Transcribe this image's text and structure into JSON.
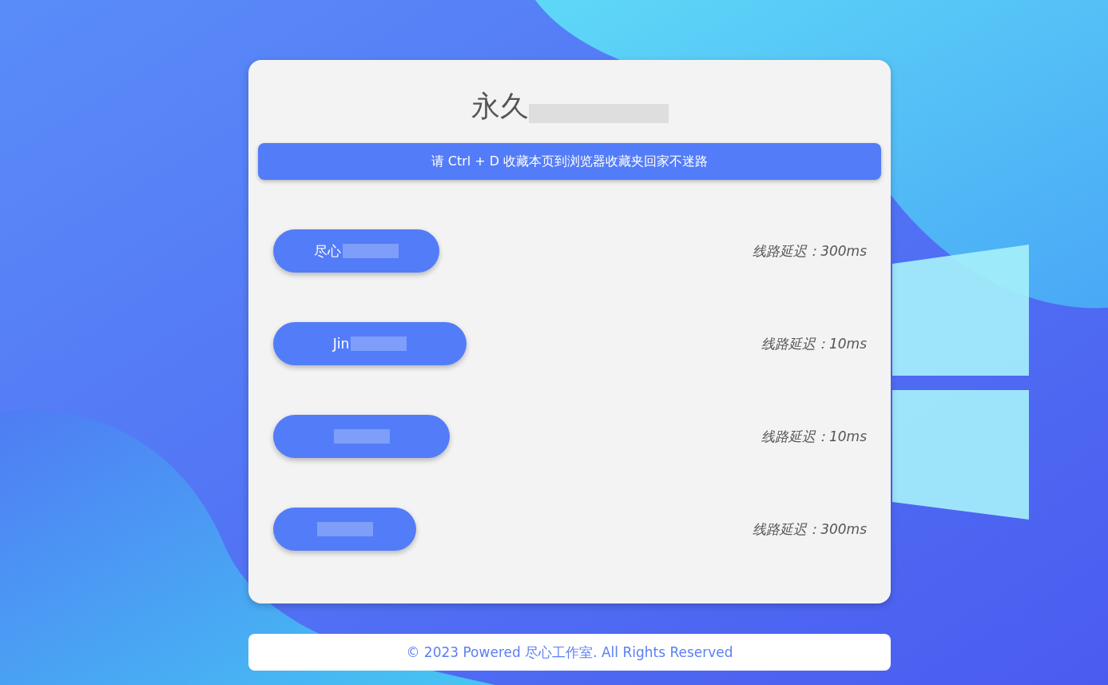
{
  "card": {
    "title": "永久",
    "notice": "请 Ctrl + D 收藏本页到浏览器收藏夹回家不迷路",
    "lines": [
      {
        "label": "尽心",
        "latency": "线路延迟：300ms"
      },
      {
        "label": "Jin",
        "latency": "线路延迟：10ms"
      },
      {
        "latency": "线路延迟：10ms"
      },
      {
        "latency": "线路延迟：300ms"
      }
    ]
  },
  "footer": {
    "text": "© 2023 Powered 尽心工作室. All Rights Reserved"
  }
}
